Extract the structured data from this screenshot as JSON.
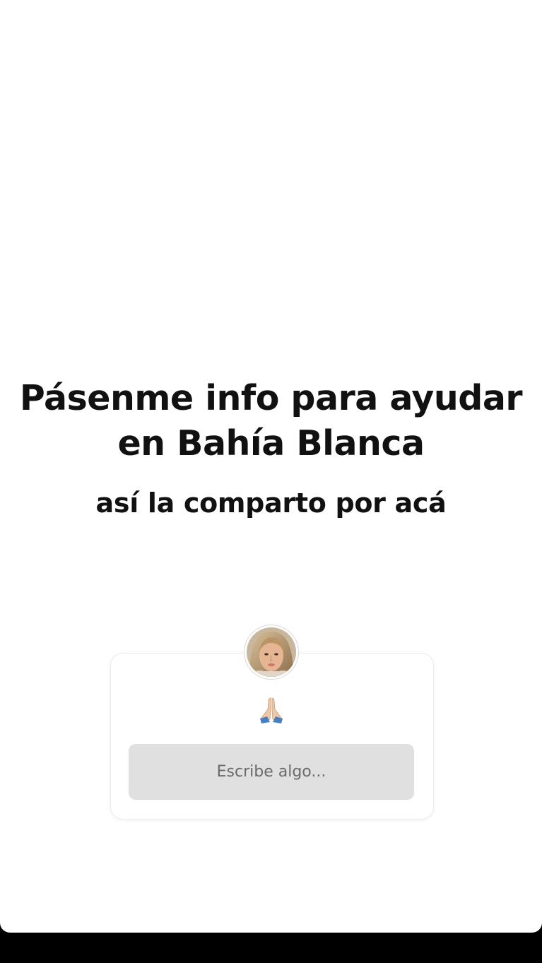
{
  "story": {
    "headline": "Pásenme info para ayudar en Bahía Blanca",
    "subline": "así la comparto por acá"
  },
  "question_sticker": {
    "avatar_icon": "user-avatar",
    "emoji": "🙏🏼",
    "emoji_icon": "folded-hands-icon",
    "placeholder": "Escribe algo..."
  },
  "colors": {
    "background": "#ffffff",
    "text": "#111111",
    "input_background": "#e0e0e0",
    "placeholder": "#6b6b6b",
    "bottom_bar": "#000000"
  }
}
